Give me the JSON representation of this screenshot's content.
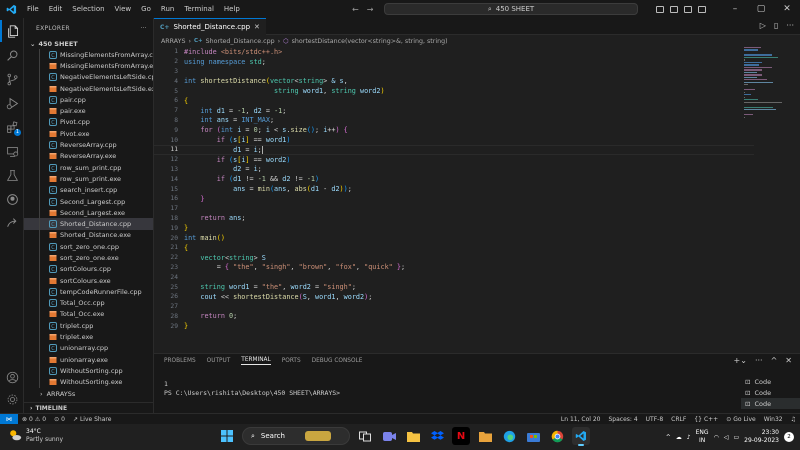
{
  "window": {
    "menu": [
      "File",
      "Edit",
      "Selection",
      "View",
      "Go",
      "Run",
      "Terminal",
      "Help"
    ],
    "search_text": "450 SHEET"
  },
  "activity_bar": {
    "items": [
      "explorer-icon",
      "search-icon",
      "source-control-icon",
      "run-debug-icon",
      "extensions-icon",
      "remote-explorer-icon",
      "testing-icon",
      "github-icon",
      "live-share-icon"
    ],
    "extensions_badge": "1",
    "accounts_icon": "account-icon",
    "settings_icon": "gear-icon"
  },
  "sidebar": {
    "title": "EXPLORER",
    "folder": "450 SHEET",
    "files": [
      {
        "name": "MissingElementsFromArray.cpp",
        "type": "cpp"
      },
      {
        "name": "MissingElementsFromArray.exe",
        "type": "exe"
      },
      {
        "name": "NegativeElementsLeftSide.cpp",
        "type": "cpp"
      },
      {
        "name": "NegativeElementsLeftSide.exe",
        "type": "exe"
      },
      {
        "name": "pair.cpp",
        "type": "cpp"
      },
      {
        "name": "pair.exe",
        "type": "exe"
      },
      {
        "name": "Pivot.cpp",
        "type": "cpp"
      },
      {
        "name": "Pivot.exe",
        "type": "exe"
      },
      {
        "name": "ReverseArray.cpp",
        "type": "cpp"
      },
      {
        "name": "ReverseArray.exe",
        "type": "exe"
      },
      {
        "name": "row_sum_print.cpp",
        "type": "cpp"
      },
      {
        "name": "row_sum_print.exe",
        "type": "exe"
      },
      {
        "name": "search_insert.cpp",
        "type": "cpp"
      },
      {
        "name": "Second_Largest.cpp",
        "type": "cpp"
      },
      {
        "name": "Second_Largest.exe",
        "type": "exe"
      },
      {
        "name": "Shorted_Distance.cpp",
        "type": "cpp",
        "selected": true
      },
      {
        "name": "Shorted_Distance.exe",
        "type": "exe"
      },
      {
        "name": "sort_zero_one.cpp",
        "type": "cpp"
      },
      {
        "name": "sort_zero_one.exe",
        "type": "exe"
      },
      {
        "name": "sortColours.cpp",
        "type": "cpp"
      },
      {
        "name": "sortColours.exe",
        "type": "exe"
      },
      {
        "name": "tempCodeRunnerFile.cpp",
        "type": "cpp"
      },
      {
        "name": "Total_Occ.cpp",
        "type": "cpp"
      },
      {
        "name": "Total_Occ.exe",
        "type": "exe"
      },
      {
        "name": "triplet.cpp",
        "type": "cpp"
      },
      {
        "name": "triplet.exe",
        "type": "exe"
      },
      {
        "name": "unionarray.cpp",
        "type": "cpp"
      },
      {
        "name": "unionarray.exe",
        "type": "exe"
      },
      {
        "name": "WithoutSorting.cpp",
        "type": "cpp"
      },
      {
        "name": "WithoutSorting.exe",
        "type": "exe"
      }
    ],
    "subfolder": "ARRAYSs",
    "timeline_label": "TIMELINE"
  },
  "editor": {
    "tab_label": "Shorted_Distance.cpp",
    "breadcrumb": [
      "ARRAYS",
      "Shorted_Distance.cpp",
      "shortestDistance(vector<string>&, string, string)"
    ],
    "current_line": 11,
    "lines": [
      [
        [
          "t-pre",
          "#include "
        ],
        [
          "t-inc",
          "<bits/stdc++.h>"
        ]
      ],
      [
        [
          "t-kw",
          "using"
        ],
        [
          "t-op",
          " "
        ],
        [
          "t-kw",
          "namespace"
        ],
        [
          "t-op",
          " "
        ],
        [
          "t-type",
          "std"
        ],
        [
          "t-op",
          ";"
        ]
      ],
      [],
      [
        [
          "t-kw",
          "int"
        ],
        [
          "t-op",
          " "
        ],
        [
          "t-fn",
          "shortestDistance"
        ],
        [
          "t-br1",
          "("
        ],
        [
          "t-type",
          "vector"
        ],
        [
          "t-op",
          "<"
        ],
        [
          "t-type",
          "string"
        ],
        [
          "t-op",
          "> "
        ],
        [
          "t-var",
          "&"
        ],
        [
          "t-op",
          " "
        ],
        [
          "t-var",
          "s"
        ],
        [
          "t-op",
          ","
        ]
      ],
      [
        [
          "t-op",
          "                      "
        ],
        [
          "t-type",
          "string"
        ],
        [
          "t-op",
          " "
        ],
        [
          "t-var",
          "word1"
        ],
        [
          "t-op",
          ", "
        ],
        [
          "t-type",
          "string"
        ],
        [
          "t-op",
          " "
        ],
        [
          "t-var",
          "word2"
        ],
        [
          "t-br1",
          ")"
        ]
      ],
      [
        [
          "t-br1",
          "{"
        ]
      ],
      [
        [
          "t-op",
          "    "
        ],
        [
          "t-kw",
          "int"
        ],
        [
          "t-op",
          " "
        ],
        [
          "t-var",
          "d1"
        ],
        [
          "t-op",
          " = "
        ],
        [
          "t-num",
          "-1"
        ],
        [
          "t-op",
          ", "
        ],
        [
          "t-var",
          "d2"
        ],
        [
          "t-op",
          " = "
        ],
        [
          "t-num",
          "-1"
        ],
        [
          "t-op",
          ";"
        ]
      ],
      [
        [
          "t-op",
          "    "
        ],
        [
          "t-kw",
          "int"
        ],
        [
          "t-op",
          " "
        ],
        [
          "t-var",
          "ans"
        ],
        [
          "t-op",
          " = "
        ],
        [
          "t-macro",
          "INT_MAX"
        ],
        [
          "t-op",
          ";"
        ]
      ],
      [
        [
          "t-op",
          "    "
        ],
        [
          "t-ctl",
          "for"
        ],
        [
          "t-op",
          " "
        ],
        [
          "t-br2",
          "("
        ],
        [
          "t-kw",
          "int"
        ],
        [
          "t-op",
          " "
        ],
        [
          "t-var",
          "i"
        ],
        [
          "t-op",
          " = "
        ],
        [
          "t-num",
          "0"
        ],
        [
          "t-op",
          "; "
        ],
        [
          "t-var",
          "i"
        ],
        [
          "t-op",
          " < "
        ],
        [
          "t-var",
          "s"
        ],
        [
          "t-op",
          "."
        ],
        [
          "t-fn",
          "size"
        ],
        [
          "t-br3",
          "()"
        ],
        [
          "t-op",
          "; "
        ],
        [
          "t-var",
          "i"
        ],
        [
          "t-op",
          "++"
        ],
        [
          "t-br2",
          ")"
        ],
        [
          "t-op",
          " "
        ],
        [
          "t-br2",
          "{"
        ]
      ],
      [
        [
          "t-op",
          "        "
        ],
        [
          "t-ctl",
          "if"
        ],
        [
          "t-op",
          " "
        ],
        [
          "t-br3",
          "("
        ],
        [
          "t-var",
          "s"
        ],
        [
          "t-br1",
          "["
        ],
        [
          "t-var",
          "i"
        ],
        [
          "t-br1",
          "]"
        ],
        [
          "t-op",
          " == "
        ],
        [
          "t-var",
          "word1"
        ],
        [
          "t-br3",
          ")"
        ]
      ],
      [
        [
          "t-op",
          "            "
        ],
        [
          "t-var",
          "d1"
        ],
        [
          "t-op",
          " = "
        ],
        [
          "t-var",
          "i"
        ],
        [
          "t-op",
          ";"
        ]
      ],
      [
        [
          "t-op",
          "        "
        ],
        [
          "t-ctl",
          "if"
        ],
        [
          "t-op",
          " "
        ],
        [
          "t-br3",
          "("
        ],
        [
          "t-var",
          "s"
        ],
        [
          "t-br1",
          "["
        ],
        [
          "t-var",
          "i"
        ],
        [
          "t-br1",
          "]"
        ],
        [
          "t-op",
          " == "
        ],
        [
          "t-var",
          "word2"
        ],
        [
          "t-br3",
          ")"
        ]
      ],
      [
        [
          "t-op",
          "            "
        ],
        [
          "t-var",
          "d2"
        ],
        [
          "t-op",
          " = "
        ],
        [
          "t-var",
          "i"
        ],
        [
          "t-op",
          ";"
        ]
      ],
      [
        [
          "t-op",
          "        "
        ],
        [
          "t-ctl",
          "if"
        ],
        [
          "t-op",
          " "
        ],
        [
          "t-br3",
          "("
        ],
        [
          "t-var",
          "d1"
        ],
        [
          "t-op",
          " != "
        ],
        [
          "t-num",
          "-1"
        ],
        [
          "t-op",
          " && "
        ],
        [
          "t-var",
          "d2"
        ],
        [
          "t-op",
          " != "
        ],
        [
          "t-num",
          "-1"
        ],
        [
          "t-br3",
          ")"
        ]
      ],
      [
        [
          "t-op",
          "            "
        ],
        [
          "t-var",
          "ans"
        ],
        [
          "t-op",
          " = "
        ],
        [
          "t-fn",
          "min"
        ],
        [
          "t-br3",
          "("
        ],
        [
          "t-var",
          "ans"
        ],
        [
          "t-op",
          ", "
        ],
        [
          "t-fn",
          "abs"
        ],
        [
          "t-br1",
          "("
        ],
        [
          "t-var",
          "d1"
        ],
        [
          "t-op",
          " - "
        ],
        [
          "t-var",
          "d2"
        ],
        [
          "t-br1",
          ")"
        ],
        [
          "t-br3",
          ")"
        ],
        [
          "t-op",
          ";"
        ]
      ],
      [
        [
          "t-op",
          "    "
        ],
        [
          "t-br2",
          "}"
        ]
      ],
      [],
      [
        [
          "t-op",
          "    "
        ],
        [
          "t-ctl",
          "return"
        ],
        [
          "t-op",
          " "
        ],
        [
          "t-var",
          "ans"
        ],
        [
          "t-op",
          ";"
        ]
      ],
      [
        [
          "t-br1",
          "}"
        ]
      ],
      [
        [
          "t-kw",
          "int"
        ],
        [
          "t-op",
          " "
        ],
        [
          "t-fn",
          "main"
        ],
        [
          "t-br1",
          "()"
        ]
      ],
      [
        [
          "t-br1",
          "{"
        ]
      ],
      [
        [
          "t-op",
          "    "
        ],
        [
          "t-type",
          "vector"
        ],
        [
          "t-op",
          "<"
        ],
        [
          "t-type",
          "string"
        ],
        [
          "t-op",
          "> "
        ],
        [
          "t-var",
          "S"
        ]
      ],
      [
        [
          "t-op",
          "        = "
        ],
        [
          "t-br2",
          "{"
        ],
        [
          "t-op",
          " "
        ],
        [
          "t-str",
          "\"the\""
        ],
        [
          "t-op",
          ", "
        ],
        [
          "t-str",
          "\"singh\""
        ],
        [
          "t-op",
          ", "
        ],
        [
          "t-str",
          "\"brown\""
        ],
        [
          "t-op",
          ", "
        ],
        [
          "t-str",
          "\"fox\""
        ],
        [
          "t-op",
          ", "
        ],
        [
          "t-str",
          "\"quick\""
        ],
        [
          "t-op",
          " "
        ],
        [
          "t-br2",
          "}"
        ],
        [
          "t-op",
          ";"
        ]
      ],
      [],
      [
        [
          "t-op",
          "    "
        ],
        [
          "t-type",
          "string"
        ],
        [
          "t-op",
          " "
        ],
        [
          "t-var",
          "word1"
        ],
        [
          "t-op",
          " = "
        ],
        [
          "t-str",
          "\"the\""
        ],
        [
          "t-op",
          ", "
        ],
        [
          "t-var",
          "word2"
        ],
        [
          "t-op",
          " = "
        ],
        [
          "t-str",
          "\"singh\""
        ],
        [
          "t-op",
          ";"
        ]
      ],
      [
        [
          "t-op",
          "    "
        ],
        [
          "t-var",
          "cout"
        ],
        [
          "t-op",
          " << "
        ],
        [
          "t-fn",
          "shortestDistance"
        ],
        [
          "t-br2",
          "("
        ],
        [
          "t-var",
          "S"
        ],
        [
          "t-op",
          ", "
        ],
        [
          "t-var",
          "word1"
        ],
        [
          "t-op",
          ", "
        ],
        [
          "t-var",
          "word2"
        ],
        [
          "t-br2",
          ")"
        ],
        [
          "t-op",
          ";"
        ]
      ],
      [],
      [
        [
          "t-op",
          "    "
        ],
        [
          "t-ctl",
          "return"
        ],
        [
          "t-op",
          " "
        ],
        [
          "t-num",
          "0"
        ],
        [
          "t-op",
          ";"
        ]
      ],
      [
        [
          "t-br1",
          "}"
        ]
      ]
    ]
  },
  "panel": {
    "tabs": [
      "PROBLEMS",
      "OUTPUT",
      "TERMINAL",
      "PORTS",
      "DEBUG CONSOLE"
    ],
    "active_tab": "TERMINAL",
    "terminal_lines": [
      "1",
      "PS C:\\Users\\rishita\\Desktop\\450 SHEET\\ARRAYS> "
    ],
    "terminal_list": [
      "Code",
      "Code",
      "Code"
    ]
  },
  "status_bar": {
    "errors": "0",
    "warnings": "0",
    "ports": "0",
    "live_share": "Live Share",
    "position": "Ln 11, Col 20",
    "spaces": "Spaces: 4",
    "encoding": "UTF-8",
    "eol": "CRLF",
    "language": "C++",
    "go_live": "Go Live",
    "platform": "Win32"
  },
  "taskbar": {
    "temperature": "34°C",
    "condition": "Partly sunny",
    "search_label": "Search",
    "lang_line1": "ENG",
    "lang_line2": "IN",
    "time": "23:30",
    "date": "29-09-2023",
    "notification_count": "2"
  }
}
